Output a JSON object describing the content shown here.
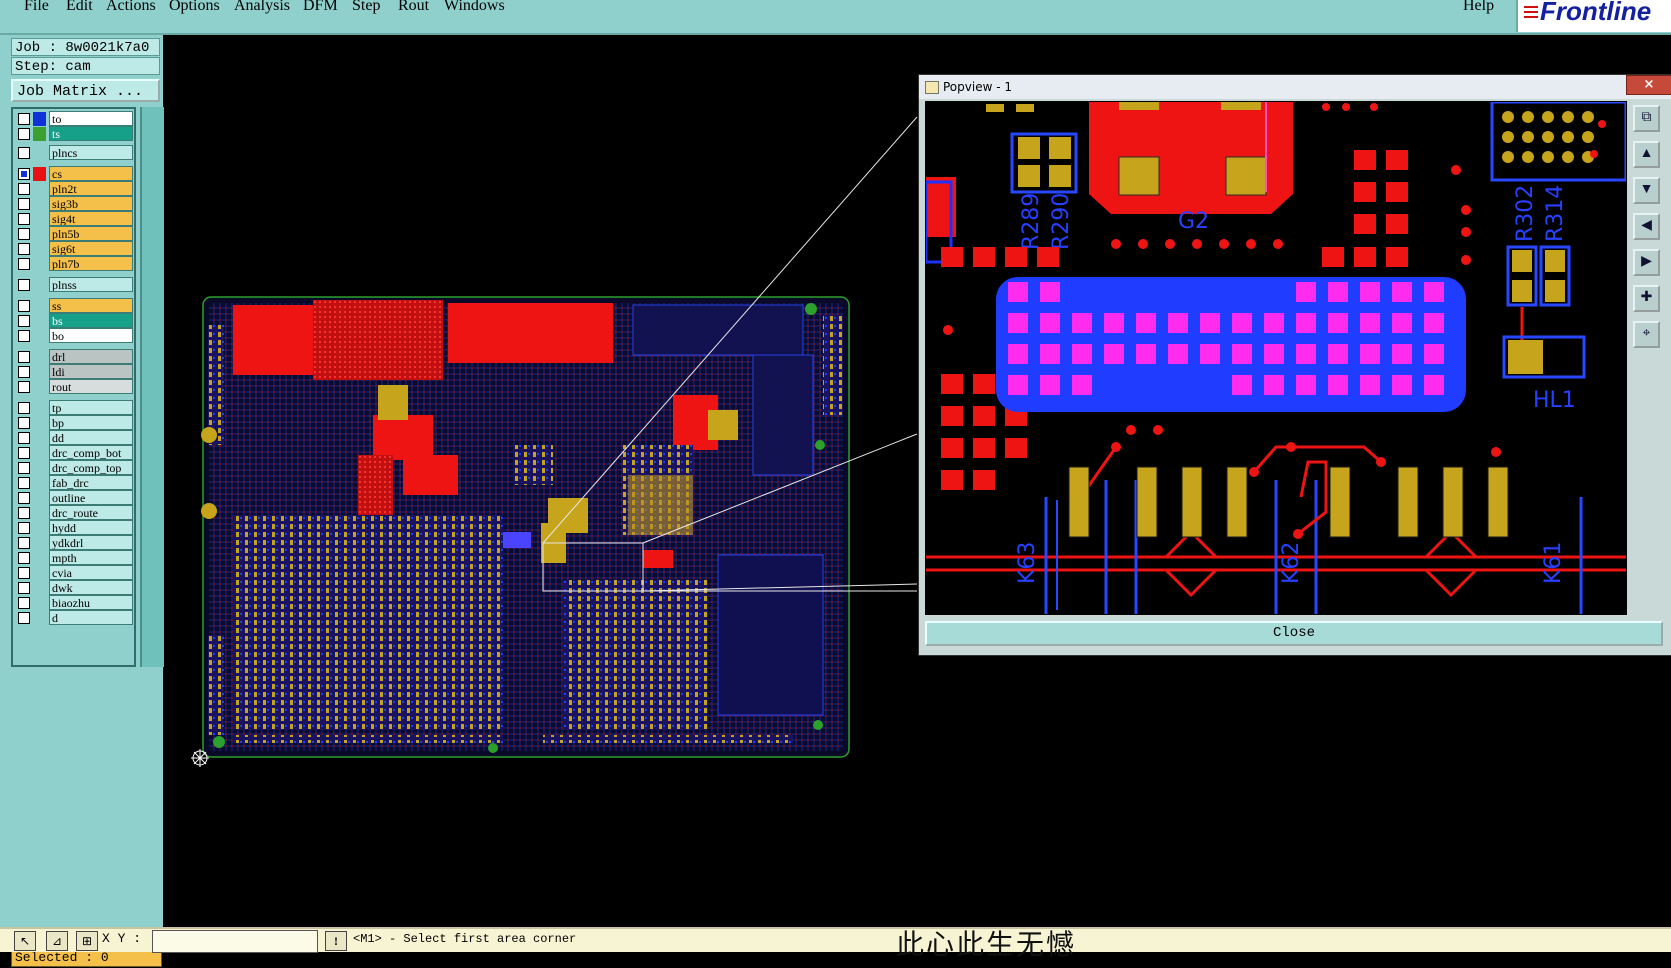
{
  "menu": {
    "items": [
      "File",
      "Edit",
      "Actions",
      "Options",
      "Analysis",
      "DFM",
      "Step",
      "Rout",
      "Windows"
    ],
    "help": "Help",
    "brand": "Frontline"
  },
  "left_panel": {
    "job": "Job : 8w0021k7a0",
    "step": "Step: cam",
    "job_matrix": "Job Matrix ...",
    "layers": [
      {
        "name": "to",
        "color": "#ffffff",
        "swatch": "#1030d8"
      },
      {
        "name": "ts",
        "color": "#16a08a",
        "swatch": "#3aa030"
      },
      {
        "name": "plncs",
        "color": "#bde9e6",
        "swatch": ""
      },
      {
        "name": "cs",
        "color": "#f5c04a",
        "swatch": "#e81010"
      },
      {
        "name": "pln2t",
        "color": "#f5c04a",
        "swatch": ""
      },
      {
        "name": "sig3b",
        "color": "#f5c04a",
        "swatch": ""
      },
      {
        "name": "sig4t",
        "color": "#f5c04a",
        "swatch": ""
      },
      {
        "name": "pln5b",
        "color": "#f5c04a",
        "swatch": ""
      },
      {
        "name": "sig6t",
        "color": "#f5c04a",
        "swatch": ""
      },
      {
        "name": "pln7b",
        "color": "#f5c04a",
        "swatch": ""
      },
      {
        "name": "plnss",
        "color": "#bde9e6",
        "swatch": ""
      },
      {
        "name": "ss",
        "color": "#f5c04a",
        "swatch": ""
      },
      {
        "name": "bs",
        "color": "#16a08a",
        "swatch": ""
      },
      {
        "name": "bo",
        "color": "#ffffff",
        "swatch": ""
      },
      {
        "name": "drl",
        "color": "#b9c4c3",
        "swatch": ""
      },
      {
        "name": "ldi",
        "color": "#b9c4c3",
        "swatch": ""
      },
      {
        "name": "rout",
        "color": "#d7dddc",
        "swatch": ""
      },
      {
        "name": "tp",
        "color": "#bde9e6",
        "swatch": ""
      },
      {
        "name": "bp",
        "color": "#bde9e6",
        "swatch": ""
      },
      {
        "name": "dd",
        "color": "#bde9e6",
        "swatch": ""
      },
      {
        "name": "drc_comp_bot",
        "color": "#bde9e6",
        "swatch": ""
      },
      {
        "name": "drc_comp_top",
        "color": "#bde9e6",
        "swatch": ""
      },
      {
        "name": "fab_drc",
        "color": "#bde9e6",
        "swatch": ""
      },
      {
        "name": "outline",
        "color": "#bde9e6",
        "swatch": ""
      },
      {
        "name": "drc_route",
        "color": "#bde9e6",
        "swatch": ""
      },
      {
        "name": "hydd",
        "color": "#bde9e6",
        "swatch": ""
      },
      {
        "name": "ydkdrl",
        "color": "#bde9e6",
        "swatch": ""
      },
      {
        "name": "mpth",
        "color": "#bde9e6",
        "swatch": ""
      },
      {
        "name": "cvia",
        "color": "#bde9e6",
        "swatch": ""
      },
      {
        "name": "dwk",
        "color": "#bde9e6",
        "swatch": ""
      },
      {
        "name": "biaozhu",
        "color": "#bde9e6",
        "swatch": ""
      },
      {
        "name": "d",
        "color": "#bde9e6",
        "swatch": ""
      }
    ],
    "selected": "Selected : 0"
  },
  "popview": {
    "title": "Popview - 1",
    "close_x": "×",
    "close_button": "Close",
    "labels": [
      "R289",
      "R290",
      "G2",
      "R302",
      "R314",
      "HL1",
      "K63",
      "K62",
      "K61"
    ]
  },
  "status_bar": {
    "xy_label": "X Y :",
    "xy_value": "",
    "hint_mark": "!",
    "hint": "<M1> - Select first area corner",
    "watermark": "此心此生无憾"
  }
}
